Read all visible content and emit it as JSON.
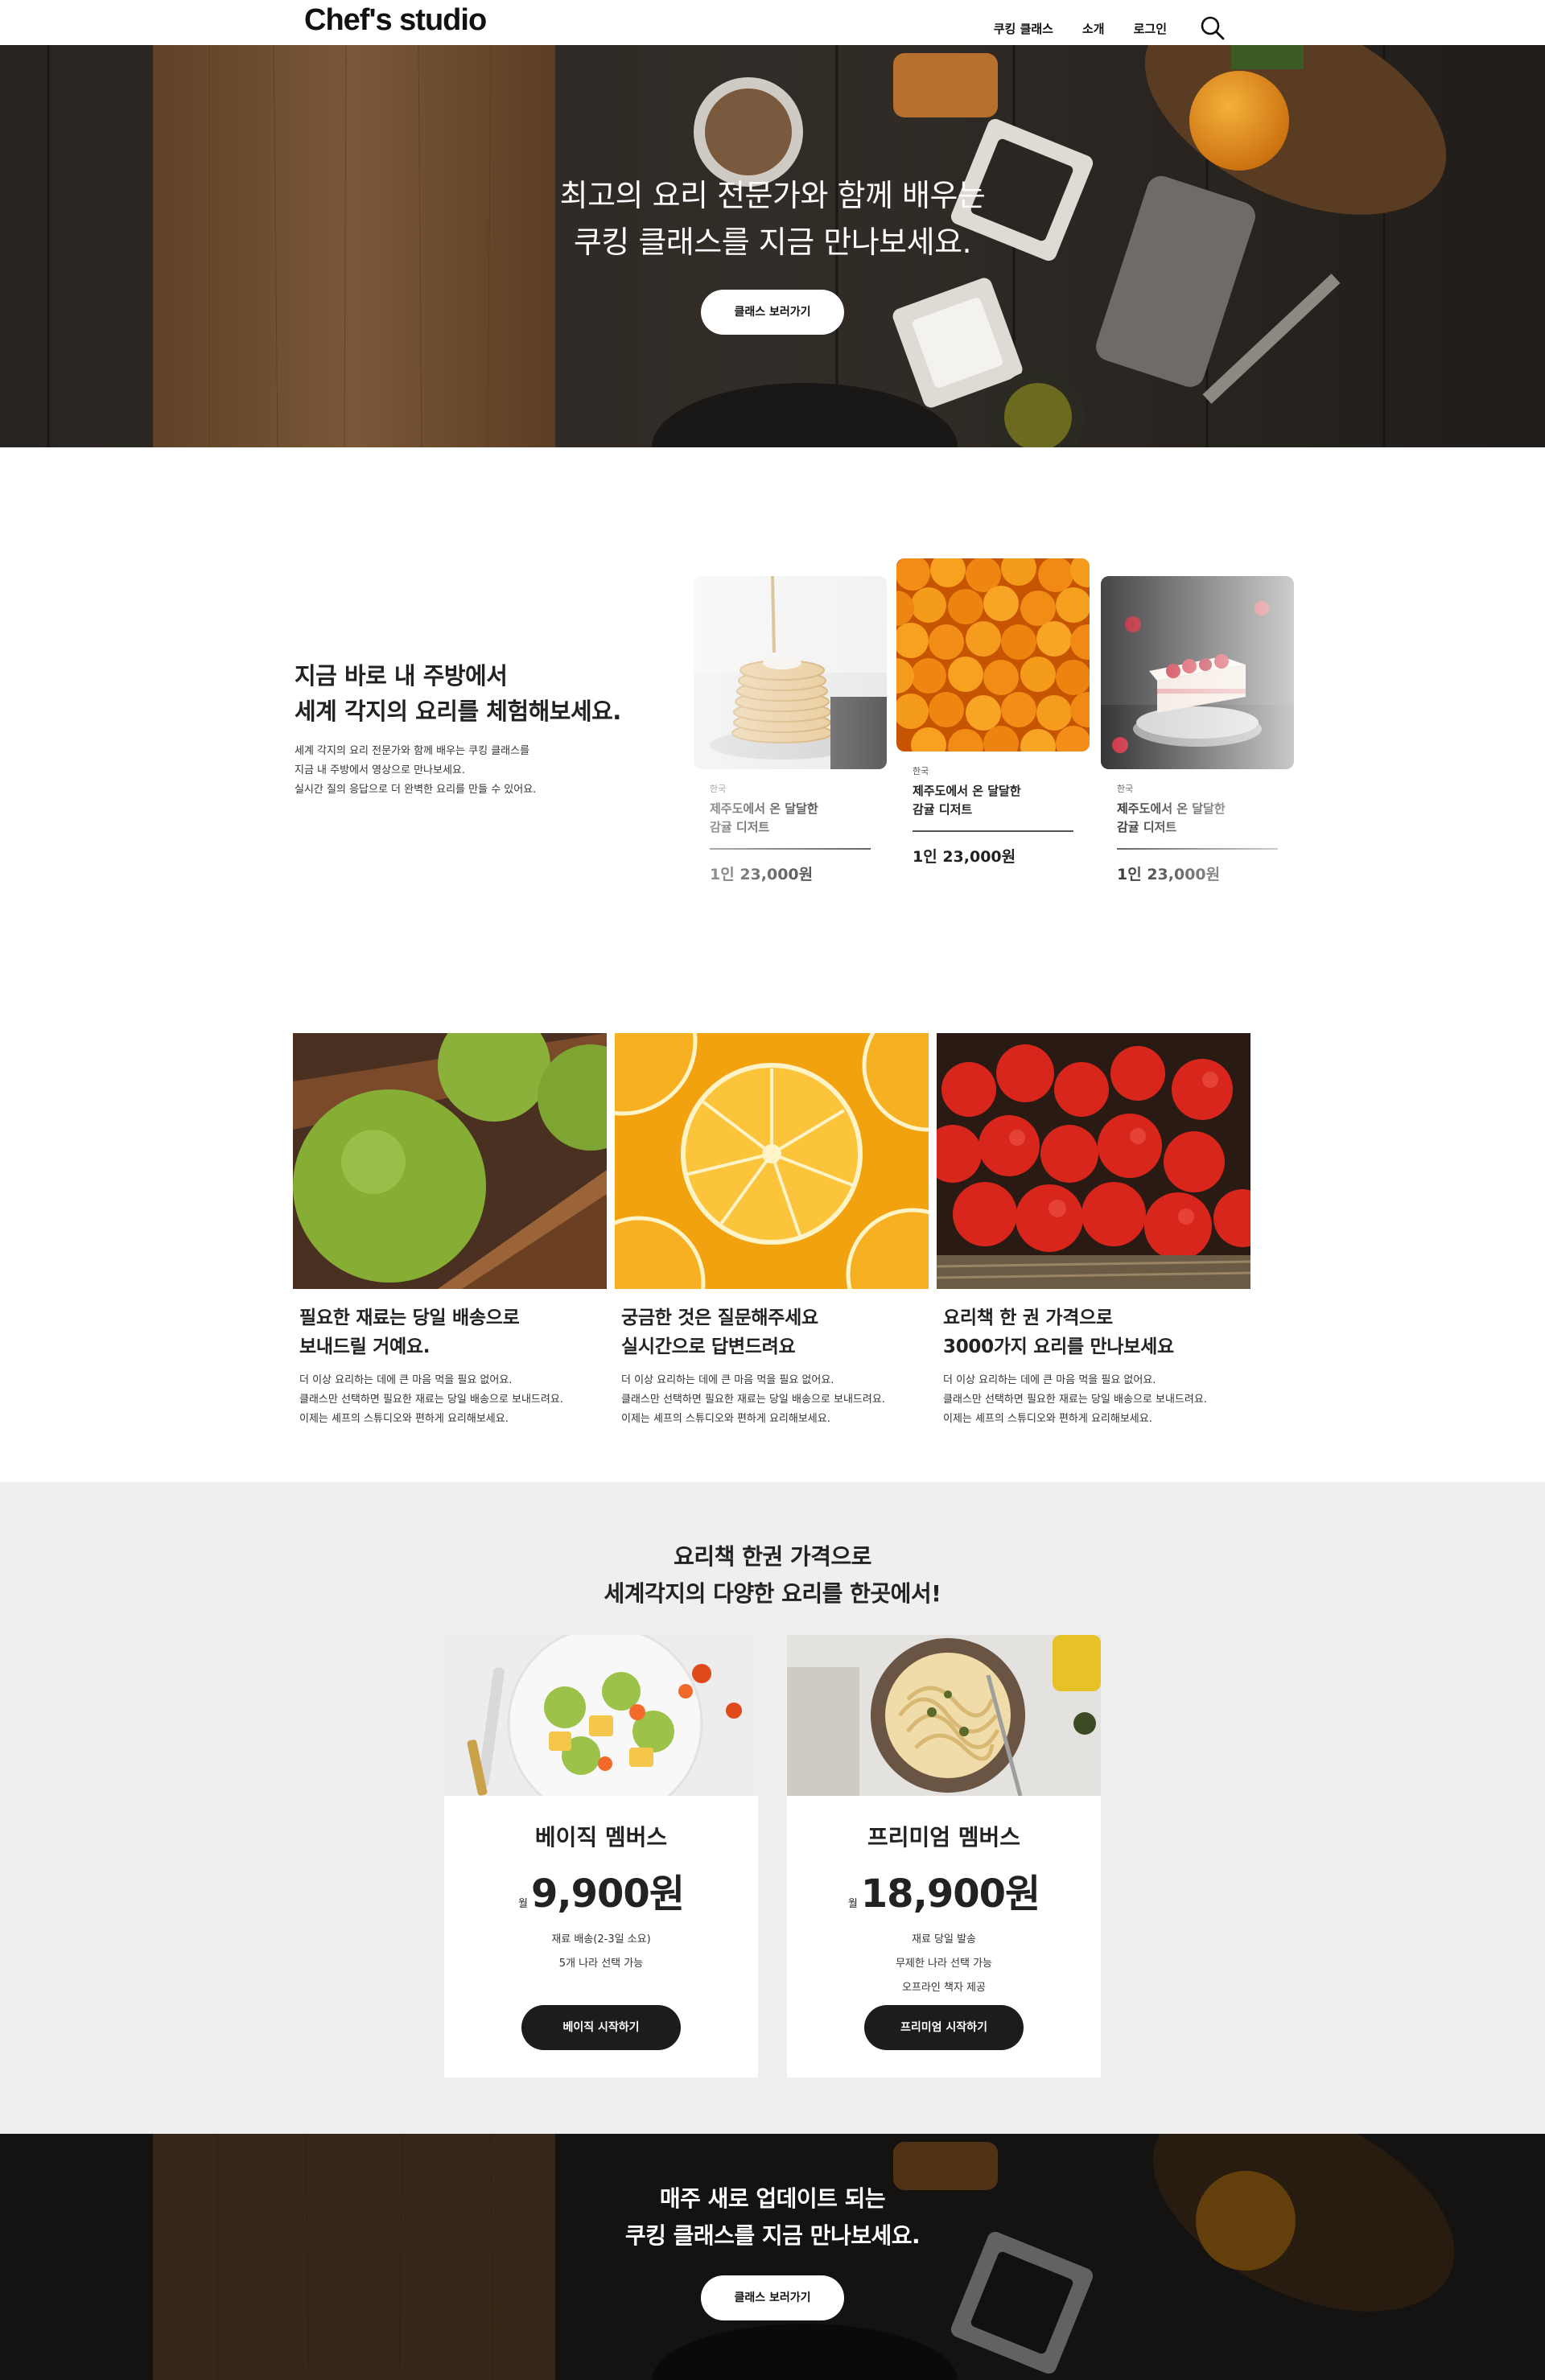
{
  "header": {
    "logo": "Chef's studio",
    "nav": [
      "쿠킹 클래스",
      "소개",
      "로그인"
    ]
  },
  "hero": {
    "title_lines": [
      "최고의 요리 전문가와 함께 배우는",
      "쿠킹 클래스를 지금 만나보세요."
    ],
    "button": "클래스 보러가기"
  },
  "intro": {
    "title_lines": [
      "지금 바로 내 주방에서",
      "세계 각지의  요리를 체험해보세요."
    ],
    "desc_lines": [
      "세계 각지의 요리 전문가와 함께 배우는 쿠킹 클래스를",
      "지금 내 주방에서 영상으로 만나보세요.",
      "실시간 질의 응답으로 더 완벽한 요리를 만들 수 있어요."
    ],
    "cards": [
      {
        "category": "한국",
        "name_lines": [
          "제주도에서 온 달달한",
          "감귤 디저트"
        ],
        "price": "1인 23,000원"
      },
      {
        "category": "한국",
        "name_lines": [
          "제주도에서 온 달달한",
          "감귤 디저트"
        ],
        "price": "1인 23,000원"
      },
      {
        "category": "한국",
        "name_lines": [
          "제주도에서 온 달달한",
          "감귤 디저트"
        ],
        "price": "1인 23,000원"
      }
    ]
  },
  "features": [
    {
      "title_lines": [
        "필요한 재료는 당일 배송으로",
        "보내드릴 거예요."
      ],
      "desc_lines": [
        "더 이상 요리하는 데에 큰 마음 먹을 필요 없어요.",
        "클래스만 선택하면 필요한 재료는 당일 배송으로 보내드려요.",
        "이제는 셰프의 스튜디오와 편하게 요리해보세요."
      ]
    },
    {
      "title_lines": [
        "궁금한 것은 질문해주세요",
        "실시간으로 답변드려요"
      ],
      "desc_lines": [
        "더 이상 요리하는 데에 큰 마음 먹을 필요 없어요.",
        "클래스만 선택하면 필요한 재료는 당일 배송으로 보내드려요.",
        "이제는 셰프의 스튜디오와 편하게 요리해보세요."
      ]
    },
    {
      "title_lines": [
        "요리책 한 권 가격으로",
        "3000가지 요리를 만나보세요"
      ],
      "desc_lines": [
        "더 이상 요리하는 데에 큰 마음 먹을 필요 없어요.",
        "클래스만 선택하면 필요한 재료는 당일 배송으로 보내드려요.",
        "이제는 셰프의 스튜디오와 편하게 요리해보세요."
      ]
    }
  ],
  "pricing": {
    "title_lines": [
      "요리책 한권 가격으로",
      "세계각지의 다양한 요리를 한곳에서!"
    ],
    "plans": [
      {
        "name": "베이직 멤버스",
        "unit": "월",
        "price": "9,900원",
        "features": [
          "재료 배송(2-3일 소요)",
          "5개 나라 선택 가능"
        ],
        "button": "베이직 시작하기"
      },
      {
        "name": "프리미엄 멤버스",
        "unit": "월",
        "price": "18,900원",
        "features": [
          "재료 당일 발송",
          "무제한 나라 선택 가능",
          "오프라인 책자 제공"
        ],
        "button": "프리미엄 시작하기"
      }
    ]
  },
  "cta": {
    "title_lines": [
      "매주 새로 업데이트 되는",
      "쿠킹 클래스를 지금 만나보세요."
    ],
    "button": "클래스 보러가기"
  }
}
